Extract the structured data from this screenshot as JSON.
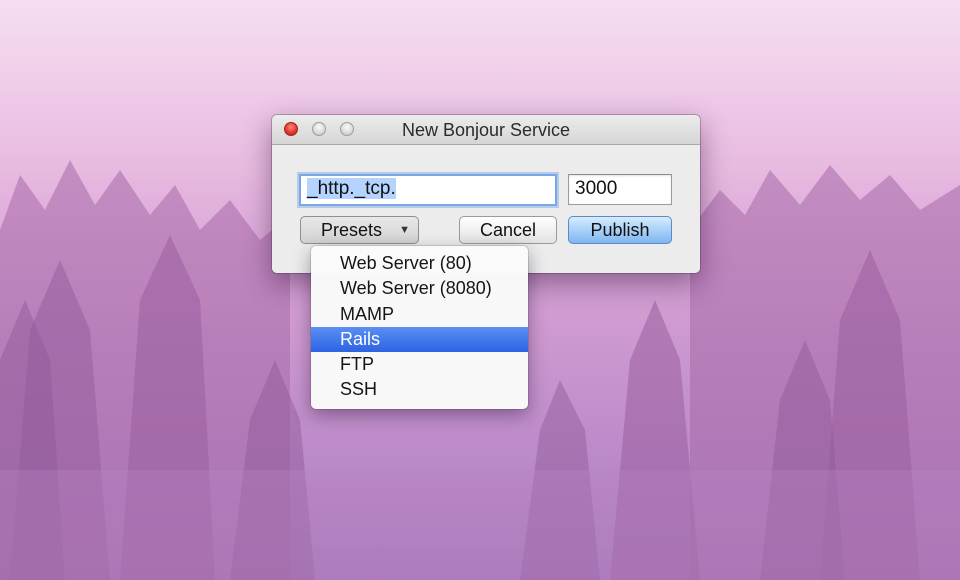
{
  "window": {
    "title": "New Bonjour Service"
  },
  "form": {
    "service_type_value": "_http._tcp.",
    "port_value": "3000",
    "presets_label": "Presets",
    "cancel_label": "Cancel",
    "publish_label": "Publish"
  },
  "presets_menu": {
    "items": [
      {
        "label": "Web Server (80)"
      },
      {
        "label": "Web Server (8080)"
      },
      {
        "label": "MAMP"
      },
      {
        "label": "Rails"
      },
      {
        "label": "FTP"
      },
      {
        "label": "SSH"
      }
    ],
    "selected_label": "Rails"
  },
  "icons": {
    "dropdown": "chevron-down-icon",
    "close": "close-icon",
    "minimize": "minimize-icon",
    "zoom": "zoom-icon"
  },
  "colors": {
    "selection_blue": "#2d63e3",
    "focus_ring": "#7aa7e6",
    "close_red": "#e33a2f",
    "wallpaper_pink": "#cd97cf"
  }
}
